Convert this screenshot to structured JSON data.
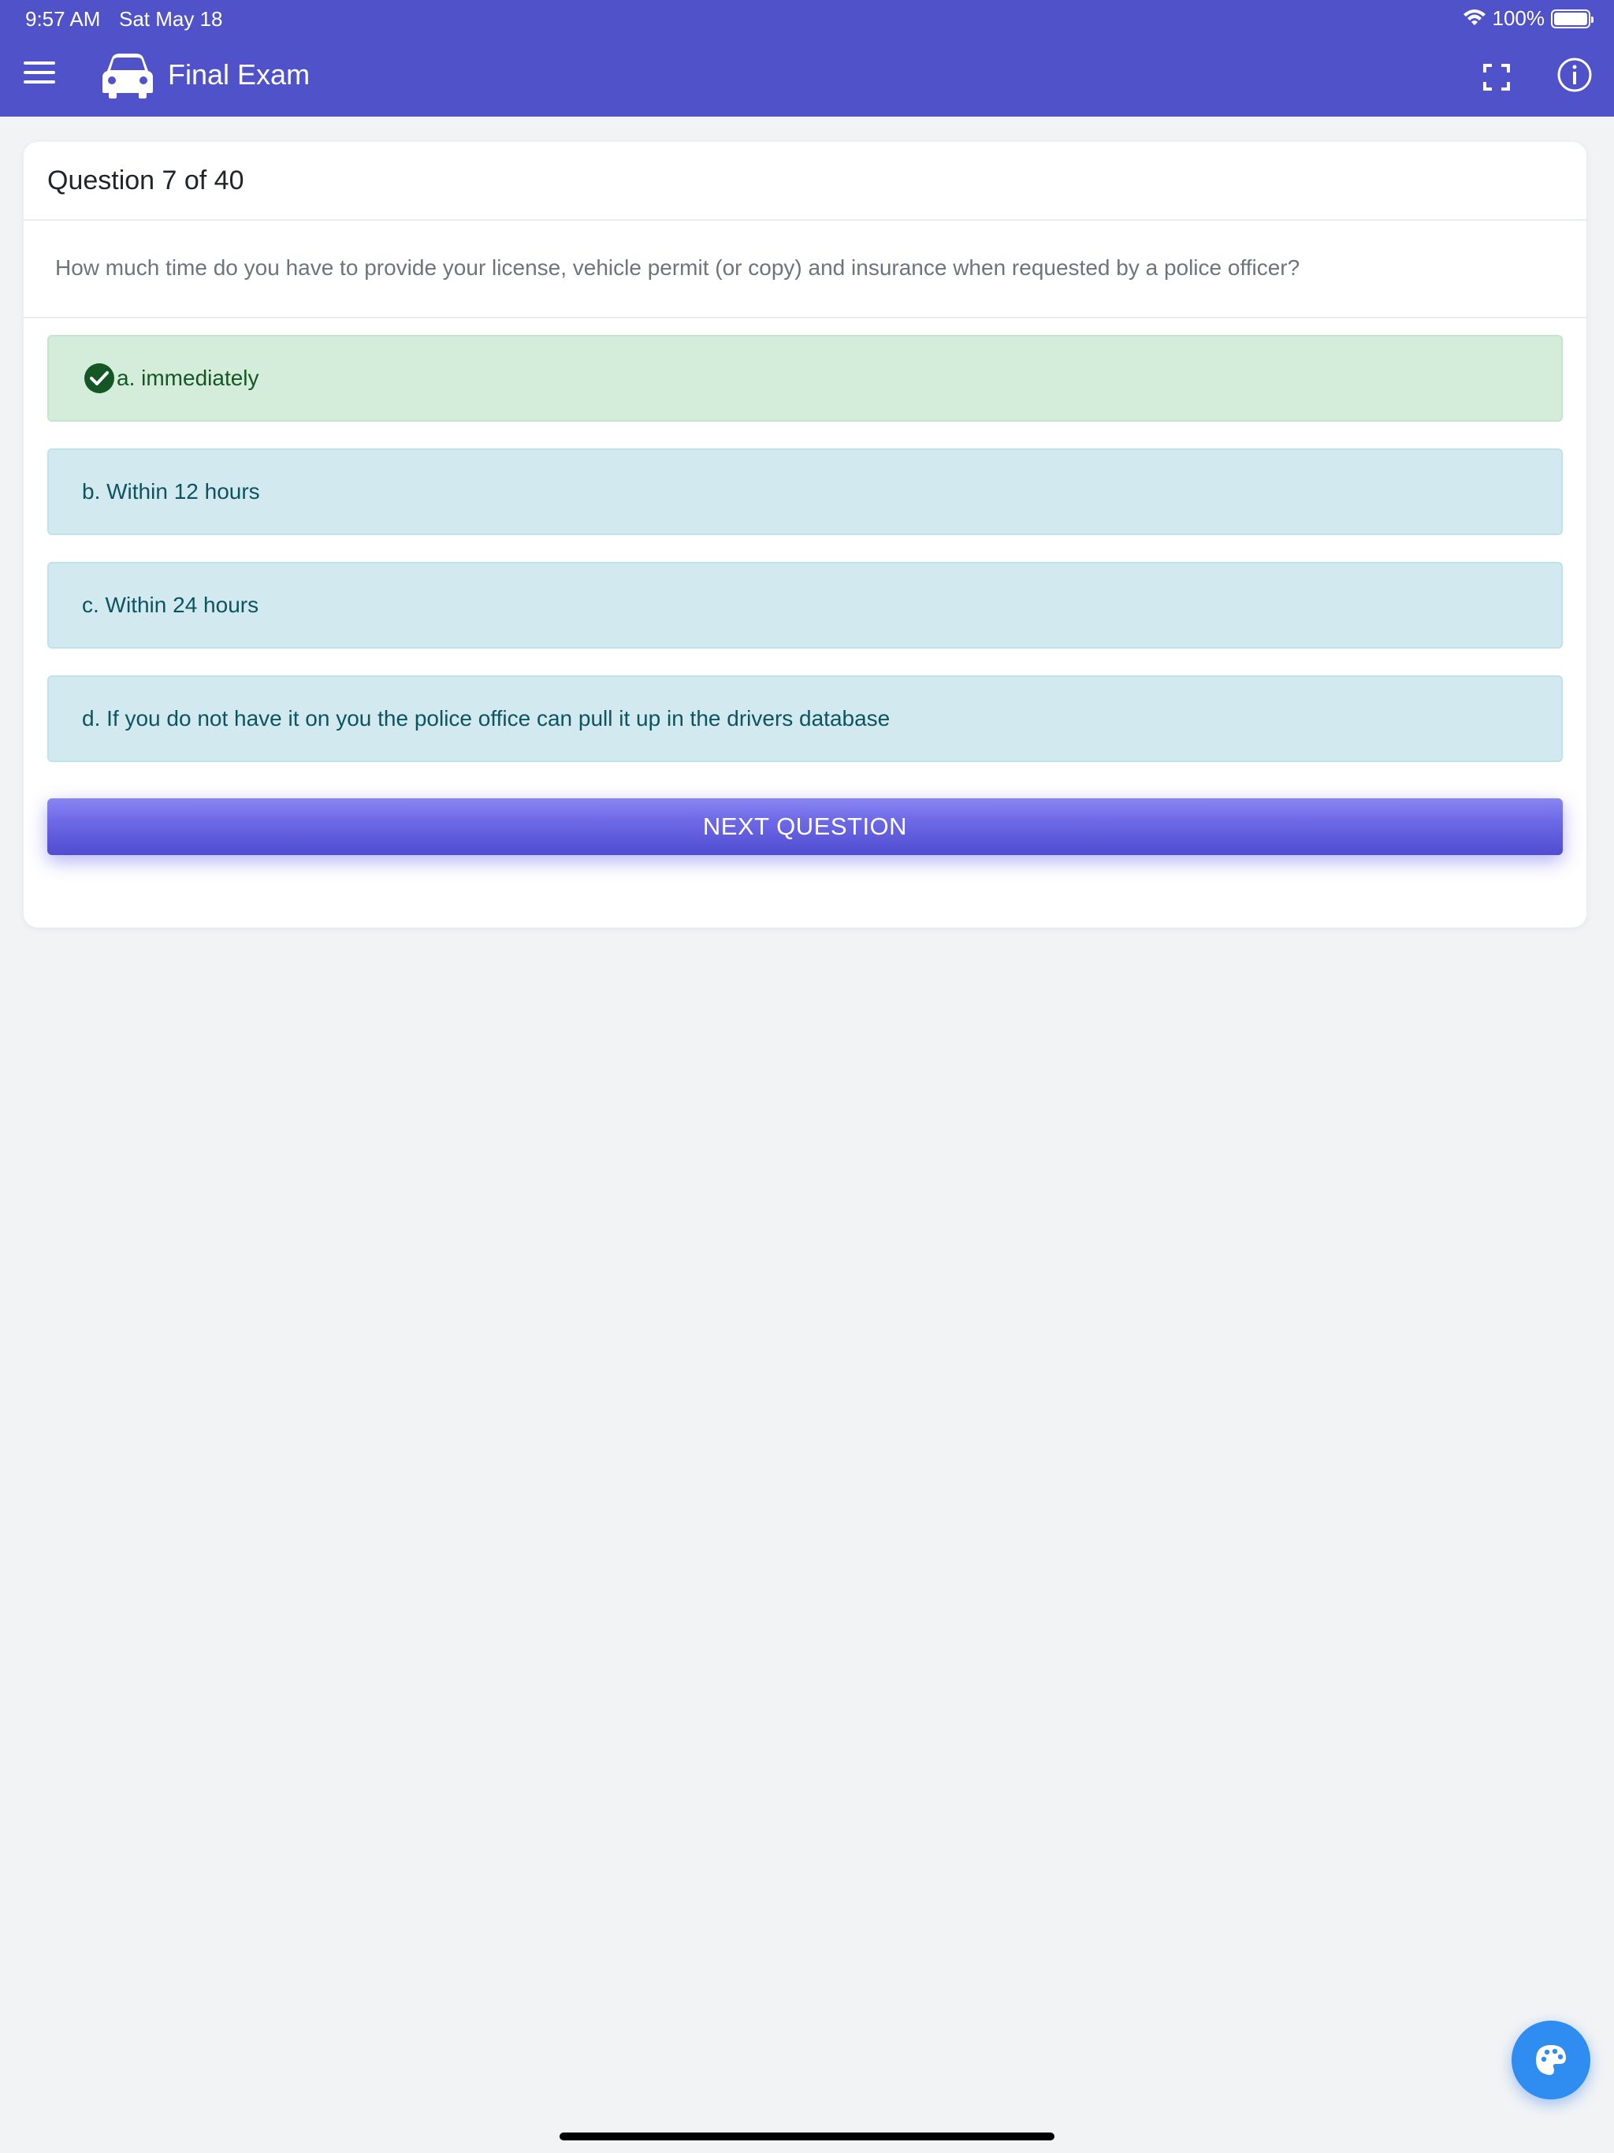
{
  "status_bar": {
    "time": "9:57 AM",
    "date": "Sat May 18",
    "battery": "100%"
  },
  "header": {
    "title": "Final Exam",
    "icons": [
      "menu-icon",
      "car-icon",
      "fullscreen-icon",
      "info-icon"
    ],
    "background": "#4f52c9"
  },
  "quiz": {
    "counter": "Question 7 of 40",
    "question": "How much time do you have to provide your license, vehicle permit (or copy) and insurance when requested by a police officer?",
    "answers": [
      {
        "label": "a. immediately",
        "state": "correct"
      },
      {
        "label": "b. Within 12 hours",
        "state": "neutral"
      },
      {
        "label": "c. Within 24 hours",
        "state": "neutral"
      },
      {
        "label": "d. If you do not have it on you the police office can pull it up in the drivers database",
        "state": "neutral"
      }
    ],
    "next_label": "NEXT QUESTION"
  },
  "fab": {
    "icon": "palette-icon",
    "color": "#2f8cf0"
  },
  "colors": {
    "correct_bg": "#d4edda",
    "neutral_bg": "#d1e9ef",
    "accent": "#6d69e6"
  }
}
